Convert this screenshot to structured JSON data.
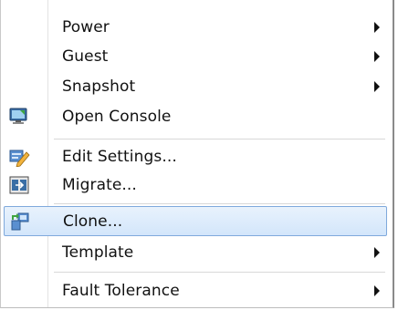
{
  "menu": {
    "items": [
      {
        "label": "Power",
        "submenu": true,
        "icon": null
      },
      {
        "label": "Guest",
        "submenu": true,
        "icon": null
      },
      {
        "label": "Snapshot",
        "submenu": true,
        "icon": null
      },
      {
        "label": "Open Console",
        "submenu": false,
        "icon": "console-monitor-icon"
      },
      {
        "label": "Edit Settings...",
        "submenu": false,
        "icon": "edit-settings-icon"
      },
      {
        "label": "Migrate...",
        "submenu": false,
        "icon": "migrate-icon"
      },
      {
        "label": "Clone...",
        "submenu": false,
        "icon": "clone-icon",
        "selected": true
      },
      {
        "label": "Template",
        "submenu": true,
        "icon": null
      },
      {
        "label": "Fault Tolerance",
        "submenu": true,
        "icon": null
      }
    ]
  },
  "colors": {
    "selection_bg": "#d3e6fb",
    "selection_border": "#7fa9dc",
    "text": "#111111"
  }
}
